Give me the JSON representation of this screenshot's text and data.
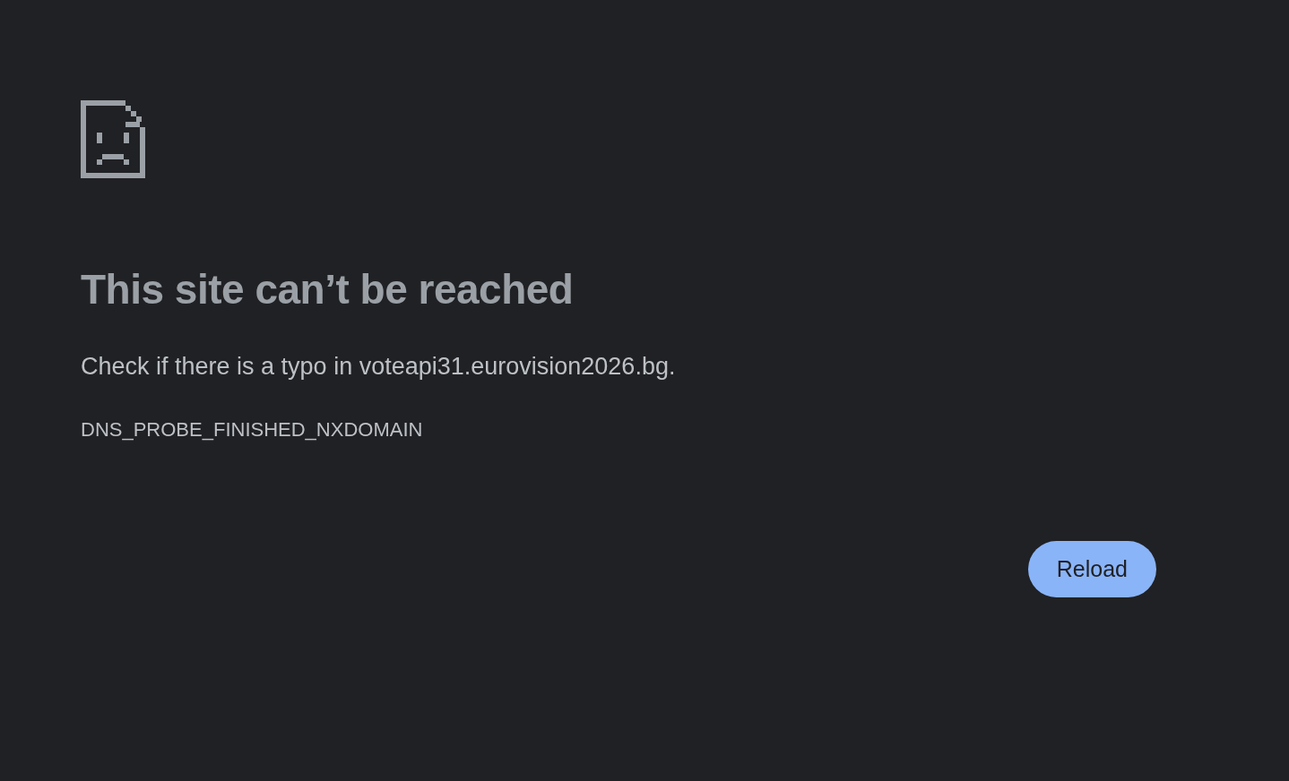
{
  "error": {
    "title": "This site can’t be reached",
    "message": "Check if there is a typo in voteapi31.eurovision2026.bg.",
    "code": "DNS_PROBE_FINISHED_NXDOMAIN"
  },
  "buttons": [
    {
      "label": "Reload",
      "kind": "primary"
    }
  ]
}
